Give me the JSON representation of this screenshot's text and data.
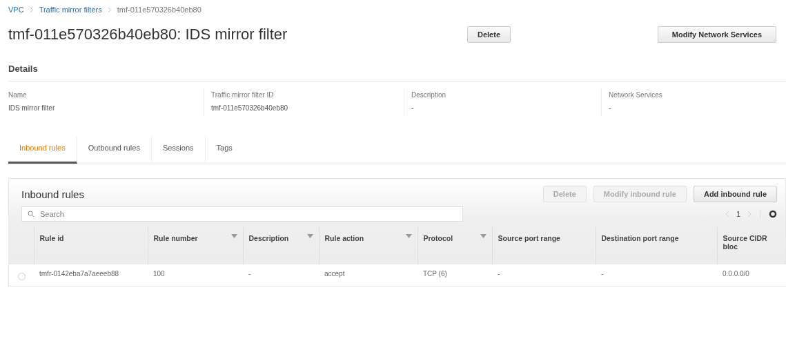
{
  "breadcrumb": [
    {
      "label": "VPC",
      "kind": "link"
    },
    {
      "label": "Traffic mirror filters",
      "kind": "link"
    },
    {
      "label": "tmf-011e570326b40eb80",
      "kind": "current"
    }
  ],
  "title": "tmf-011e570326b40eb80: IDS mirror filter",
  "actions": [
    {
      "label": "Delete"
    },
    {
      "label": "Modify Network Services"
    }
  ],
  "details": {
    "heading": "Details",
    "fields": [
      {
        "label": "Name",
        "value": "IDS mirror filter"
      },
      {
        "label": "Traffic mirror filter ID",
        "value": "tmf-011e570326b40eb80"
      },
      {
        "label": "Description",
        "value": "-"
      },
      {
        "label": "Network Services",
        "value": "-"
      }
    ]
  },
  "tabs": [
    {
      "label": "Inbound rules",
      "selected": true
    },
    {
      "label": "Outbound rules",
      "selected": false
    },
    {
      "label": "Sessions",
      "selected": false
    },
    {
      "label": "Tags",
      "selected": false
    }
  ],
  "panel": {
    "title": "Inbound rules",
    "buttons": [
      {
        "label": "Delete",
        "disabled": true
      },
      {
        "label": "Modify inbound rule",
        "disabled": true
      },
      {
        "label": "Add inbound rule",
        "disabled": false
      }
    ],
    "search": {
      "placeholder": "Search"
    },
    "pager": {
      "page": "1"
    },
    "table": {
      "columns": [
        {
          "label": "Rule id",
          "sortable": false
        },
        {
          "label": "Rule number",
          "sortable": true
        },
        {
          "label": "Description",
          "sortable": true
        },
        {
          "label": "Rule action",
          "sortable": true
        },
        {
          "label": "Protocol",
          "sortable": true
        },
        {
          "label": "Source port range",
          "sortable": false
        },
        {
          "label": "Destination port range",
          "sortable": false
        },
        {
          "label": "Source CIDR bloc",
          "sortable": false
        }
      ],
      "rows": [
        {
          "selected": false,
          "cells": [
            "tmfr-0142eba7a7aeeeb88",
            "100",
            "-",
            "accept",
            "TCP (6)",
            "-",
            "-",
            "0.0.0.0/0"
          ]
        }
      ]
    }
  }
}
